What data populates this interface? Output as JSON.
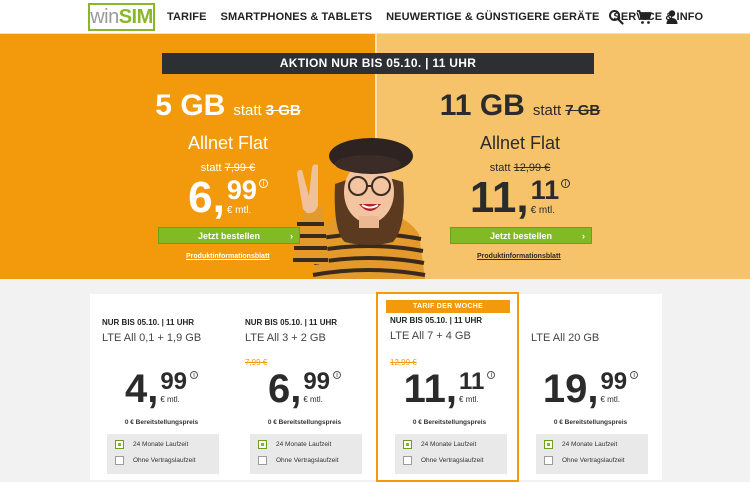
{
  "header": {
    "logo_prefix": "win",
    "logo_brand": "SIM",
    "nav": [
      "TARIFE",
      "SMARTPHONES & TABLETS",
      "NEUWERTIGE & GÜNSTIGERE GERÄTE",
      "SERVICE & INFO"
    ],
    "icons": [
      "search-icon",
      "cart-icon",
      "user-icon"
    ]
  },
  "hero": {
    "aktion_banner": "AKTION NUR BIS 05.10. | 11 UHR",
    "left": {
      "gb": "5 GB",
      "statt": "statt",
      "old_gb": "3 GB",
      "flat": "Allnet Flat",
      "statt_price_label": "statt",
      "old_price": "7,99 €",
      "price_int": "6",
      "price_dec": "99",
      "unit": "€ mtl.",
      "button": "Jetzt bestellen",
      "info_link": "Produktinformationsblatt"
    },
    "right": {
      "gb": "11 GB",
      "statt": "statt",
      "old_gb": "7 GB",
      "flat": "Allnet Flat",
      "statt_price_label": "statt",
      "old_price": "12,99 €",
      "price_int": "11",
      "price_dec": "11",
      "unit": "€ mtl.",
      "button": "Jetzt bestellen",
      "info_link": "Produktinformationsblatt"
    },
    "colors": {
      "left_bg": "#f29a0c",
      "right_bg": "#f6c36b",
      "button": "#82ba25"
    }
  },
  "cards": [
    {
      "promo": "NUR BIS 05.10. | 11 UHR",
      "name": "LTE All 0,1 + 1,9 GB",
      "old_price": "",
      "price_int": "4",
      "price_dec": "99",
      "unit": "€ mtl.",
      "bereit": "0 € Bereitstellungspreis",
      "opt1": "24 Monate Laufzeit",
      "opt2": "Ohne Vertragslaufzeit",
      "opt1_checked": true
    },
    {
      "promo": "NUR BIS 05.10. | 11 UHR",
      "name": "LTE All 3 + 2 GB",
      "old_price": "7,99 €",
      "price_int": "6",
      "price_dec": "99",
      "unit": "€ mtl.",
      "bereit": "0 € Bereitstellungspreis",
      "opt1": "24 Monate Laufzeit",
      "opt2": "Ohne Vertragslaufzeit",
      "opt1_checked": true
    },
    {
      "badge": "TARIF DER WOCHE",
      "promo": "NUR BIS 05.10. | 11 UHR",
      "name": "LTE All 7 + 4 GB",
      "old_price": "12,99 €",
      "price_int": "11",
      "price_dec": "11",
      "unit": "€ mtl.",
      "bereit": "0 € Bereitstellungspreis",
      "opt1": "24 Monate Laufzeit",
      "opt2": "Ohne Vertragslaufzeit",
      "opt1_checked": true
    },
    {
      "promo": "",
      "name": "LTE All 20 GB",
      "old_price": "",
      "price_int": "19",
      "price_dec": "99",
      "unit": "€ mtl.",
      "bereit": "0 € Bereitstellungspreis",
      "opt1": "24 Monate Laufzeit",
      "opt2": "Ohne Vertragslaufzeit",
      "opt1_checked": true
    }
  ]
}
